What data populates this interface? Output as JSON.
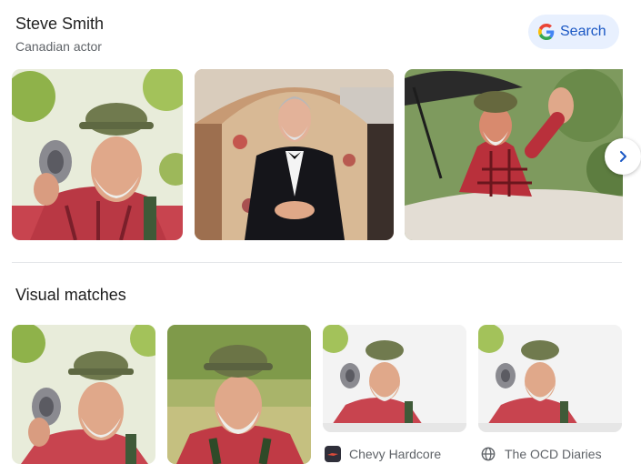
{
  "entity": {
    "name": "Steve Smith",
    "description": "Canadian actor"
  },
  "search_button": {
    "label": "Search",
    "icon": "google-g-icon"
  },
  "images_section": {
    "next_icon": "chevron-right-icon"
  },
  "visual_matches": {
    "title": "Visual matches",
    "items": [
      {
        "source": ""
      },
      {
        "source": ""
      },
      {
        "source": "Chevy Hardcore",
        "icon": "chevy-hardcore-favicon"
      },
      {
        "source": "The OCD Diaries",
        "icon": "globe-icon"
      }
    ]
  },
  "colors": {
    "accent": "#1a57c4",
    "button_bg": "#e8f0fe"
  }
}
